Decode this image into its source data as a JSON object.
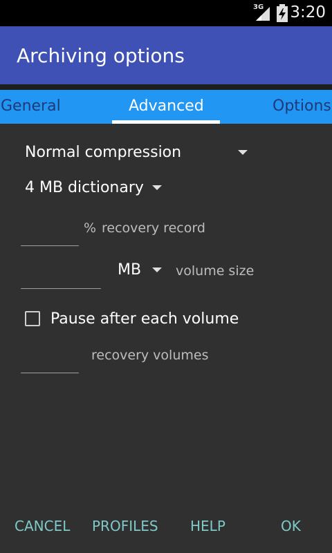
{
  "status_bar": {
    "network": "3G",
    "time": "3:20"
  },
  "title": "Archiving options",
  "tabs": [
    {
      "label": "General",
      "active": false
    },
    {
      "label": "Advanced",
      "active": true
    },
    {
      "label": "Options",
      "active": false
    }
  ],
  "form": {
    "compression": {
      "selected": "Normal compression"
    },
    "dictionary": {
      "selected": "4 MB dictionary"
    },
    "recovery_record": {
      "value": "",
      "unit": "%",
      "label": "recovery record"
    },
    "volume": {
      "value": "",
      "unit_selected": "MB",
      "label": "volume size"
    },
    "pause_after_volume": {
      "label": "Pause after each volume",
      "checked": false
    },
    "recovery_volumes": {
      "value": "",
      "label": "recovery volumes"
    }
  },
  "buttons": {
    "cancel": "CANCEL",
    "profiles": "PROFILES",
    "help": "HELP",
    "ok": "OK"
  },
  "colors": {
    "title_bar": "#3f51b5",
    "tab_bar": "#2196f3",
    "background": "#303030",
    "button_text": "#7ecac8"
  },
  "icons": [
    "signal-icon",
    "battery-charging-icon",
    "dropdown-arrow-icon",
    "checkbox-icon"
  ]
}
